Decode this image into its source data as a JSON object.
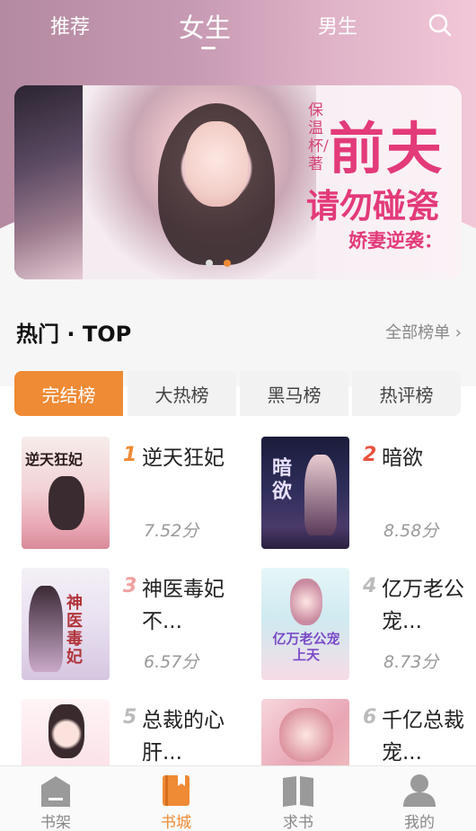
{
  "topnav": {
    "tabs": [
      {
        "label": "推荐"
      },
      {
        "label": "女生"
      },
      {
        "label": "男生"
      }
    ],
    "active_tab": "女生",
    "search_icon": "search-icon"
  },
  "banner": {
    "author": "保温杯/著",
    "title_line1": "前夫",
    "title_line2": "请勿碰瓷",
    "subtitle": "娇妻逆袭：",
    "page_count": 2,
    "active_page": 2
  },
  "section": {
    "title": "热门 · TOP",
    "all_lists": "全部榜单 ›"
  },
  "segments": [
    {
      "label": "完结榜"
    },
    {
      "label": "大热榜"
    },
    {
      "label": "黑马榜"
    },
    {
      "label": "热评榜"
    }
  ],
  "active_segment": "完结榜",
  "books": [
    {
      "rank": "1",
      "name": "逆天狂妃",
      "score": "7.52分",
      "cover_text": "逆天狂妃"
    },
    {
      "rank": "2",
      "name": "暗欲",
      "score": "8.58分",
      "cover_text": "暗欲"
    },
    {
      "rank": "3",
      "name": "神医毒妃不...",
      "score": "6.57分",
      "cover_text": "神医毒妃"
    },
    {
      "rank": "4",
      "name": "亿万老公宠...",
      "score": "8.73分",
      "cover_text": "亿万老公宠上天"
    },
    {
      "rank": "5",
      "name": "总裁的心肝...",
      "score": "",
      "cover_text": ""
    },
    {
      "rank": "6",
      "name": "千亿总裁宠...",
      "score": "",
      "cover_text": ""
    }
  ],
  "rank_colors": {
    "1": "#ef8a35",
    "2": "#e8523f",
    "3": "#f0a0a0",
    "other": "#bbbbbb"
  },
  "bottomnav": [
    {
      "label": "书架",
      "icon": "bookshelf-icon"
    },
    {
      "label": "书城",
      "icon": "bookstore-icon"
    },
    {
      "label": "求书",
      "icon": "request-book-icon"
    },
    {
      "label": "我的",
      "icon": "profile-icon"
    }
  ],
  "active_nav": "书城",
  "colors": {
    "accent": "#ef8a35"
  }
}
